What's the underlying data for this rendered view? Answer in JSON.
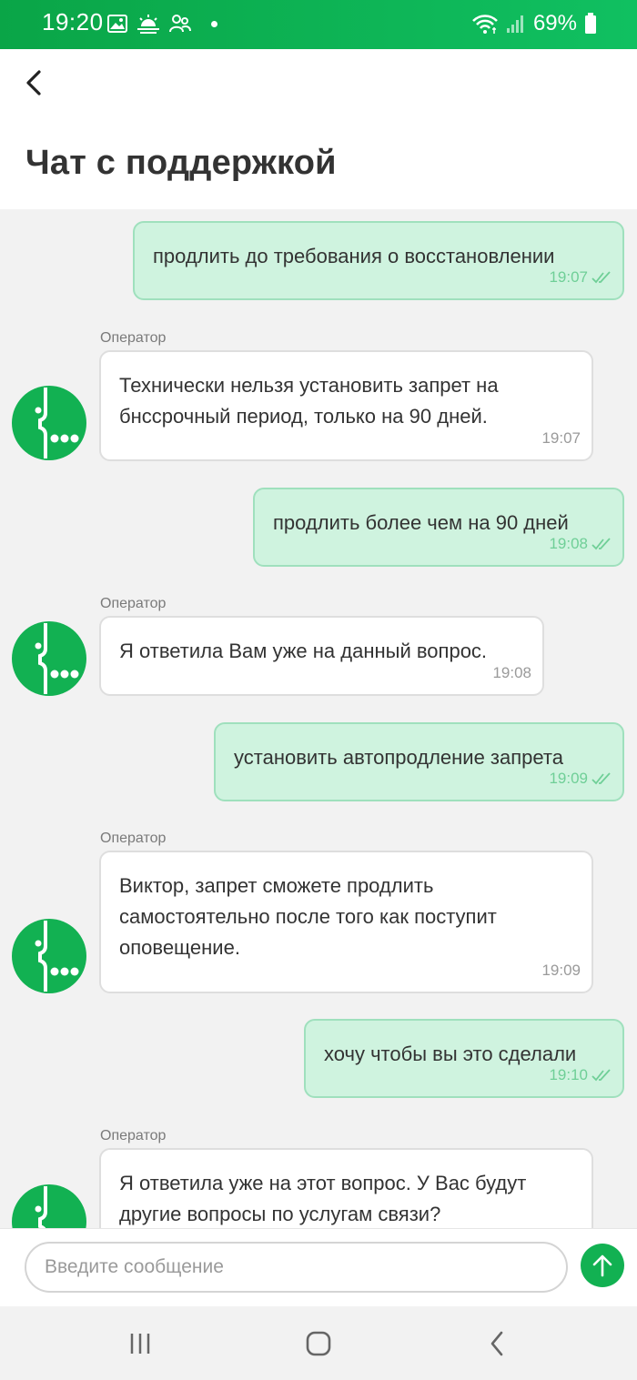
{
  "colors": {
    "accent": "#12b152",
    "outgoing_bubble": "#cff3df",
    "incoming_bubble": "#ffffff",
    "status_bar": "#0aa547"
  },
  "status_bar": {
    "time": "19:20",
    "battery": "69%",
    "left_icons": [
      "image-icon",
      "weather-icon",
      "people-icon",
      "dot-icon"
    ],
    "right_icons": [
      "wifi-icon",
      "signal-icon",
      "battery-icon"
    ]
  },
  "header": {
    "title": "Чат с поддержкой",
    "back_icon": "chevron-left-icon"
  },
  "chat": {
    "messages": [
      {
        "direction": "out",
        "text": "продлить до требования о восстановлении",
        "time": "19:07",
        "read": true
      },
      {
        "direction": "in",
        "sender": "Оператор",
        "text": "Технически нельзя установить запрет на\nбнссрочный период, только на 90 дней.",
        "time": "19:07"
      },
      {
        "direction": "out",
        "text": "продлить более чем на 90 дней",
        "time": "19:08",
        "read": true
      },
      {
        "direction": "in",
        "sender": "Оператор",
        "text": "Я ответила Вам уже на данный вопрос.",
        "time": "19:08"
      },
      {
        "direction": "out",
        "text": "установить автопродление запрета",
        "time": "19:09",
        "read": true
      },
      {
        "direction": "in",
        "sender": "Оператор",
        "text": "Виктор, запрет сможете продлить\nсамостоятельно после того как поступит\nоповещение.",
        "time": "19:09"
      },
      {
        "direction": "out",
        "text": "хочу чтобы вы это сделали",
        "time": "19:10",
        "read": true
      },
      {
        "direction": "in",
        "sender": "Оператор",
        "text": "Я ответила уже на этот вопрос. У Вас будут\nдругие вопросы по услугам связи?",
        "time": ""
      }
    ]
  },
  "composer": {
    "placeholder": "Введите сообщение",
    "value": "",
    "send_icon": "arrow-up-icon"
  },
  "nav_bar": {
    "icons": [
      "recent-apps-icon",
      "home-icon",
      "back-icon"
    ]
  }
}
